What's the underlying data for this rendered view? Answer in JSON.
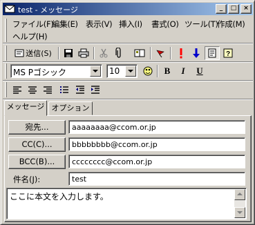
{
  "window": {
    "title": "test - メッセージ",
    "controls": {
      "minimize": "_",
      "maximize": "□",
      "close": "×"
    }
  },
  "menu": {
    "items": [
      "ファイル(F)",
      "編集(E)",
      "表示(V)",
      "挿入(I)",
      "書式(O)",
      "ツール(T)",
      "作成(M)",
      "ヘルプ(H)"
    ]
  },
  "toolbar": {
    "send_label": "送信(S)",
    "icons": [
      "send-icon",
      "save-icon",
      "print-icon",
      "cut-icon",
      "attach-icon",
      "address-book-icon",
      "flag-icon",
      "high-priority-icon",
      "low-priority-icon",
      "properties-icon",
      "help-icon"
    ]
  },
  "format": {
    "font": "MS Pゴシック",
    "size": "10",
    "bold": "B",
    "italic": "I",
    "underline": "U"
  },
  "tabs": [
    {
      "label": "メッセージ",
      "active": true
    },
    {
      "label": "オプション",
      "active": false
    }
  ],
  "fields": {
    "to_button": "宛先...",
    "to_value": "aaaaaaaa@ccom.or.jp",
    "cc_button": "CC(C)...",
    "cc_value": "bbbbbbbb@ccom.or.jp",
    "bcc_button": "BCC(B)...",
    "bcc_value": "cccccccc@ccom.or.jp",
    "subject_label": "件名(J):",
    "subject_value": "test"
  },
  "body": {
    "text": "ここに本文を入力します。"
  },
  "colors": {
    "titlebar_start": "#0a246a",
    "titlebar_end": "#a6caf0",
    "face": "#d4d0c8",
    "flag": "#cc0000",
    "priority_high": "#ff0000",
    "priority_low": "#0000cc"
  }
}
